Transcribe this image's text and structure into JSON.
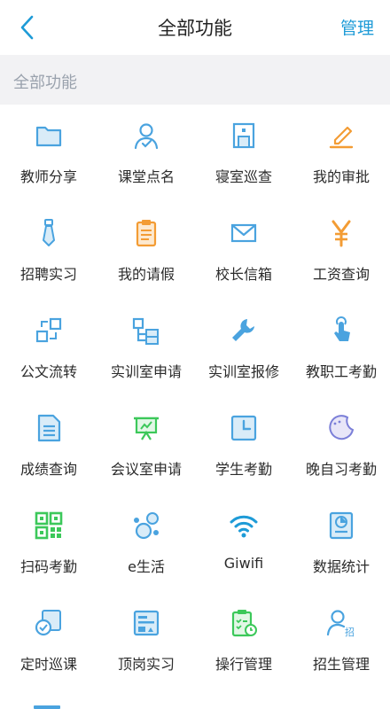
{
  "header": {
    "title": "全部功能",
    "manage_label": "管理"
  },
  "section": {
    "title": "全部功能"
  },
  "items": [
    {
      "label": "教师分享",
      "icon": "folder-icon"
    },
    {
      "label": "课堂点名",
      "icon": "user-check-icon"
    },
    {
      "label": "寝室巡查",
      "icon": "door-icon"
    },
    {
      "label": "我的审批",
      "icon": "pen-icon"
    },
    {
      "label": "招聘实习",
      "icon": "necktie-icon"
    },
    {
      "label": "我的请假",
      "icon": "clipboard-icon"
    },
    {
      "label": "校长信箱",
      "icon": "mail-icon"
    },
    {
      "label": "工资查询",
      "icon": "yen-icon"
    },
    {
      "label": "公文流转",
      "icon": "flow-icon"
    },
    {
      "label": "实训室申请",
      "icon": "tree-icon"
    },
    {
      "label": "实训室报修",
      "icon": "wrench-icon"
    },
    {
      "label": "教职工考勤",
      "icon": "hand-pointer-icon"
    },
    {
      "label": "成绩查询",
      "icon": "document-icon"
    },
    {
      "label": "会议室申请",
      "icon": "presentation-icon"
    },
    {
      "label": "学生考勤",
      "icon": "clock-icon"
    },
    {
      "label": "晚自习考勤",
      "icon": "moon-icon"
    },
    {
      "label": "扫码考勤",
      "icon": "qr-code-icon"
    },
    {
      "label": "e生活",
      "icon": "bubbles-icon"
    },
    {
      "label": "Giwifi",
      "icon": "wifi-icon"
    },
    {
      "label": "数据统计",
      "icon": "chart-icon"
    },
    {
      "label": "定时巡课",
      "icon": "patrol-icon"
    },
    {
      "label": "顶岗实习",
      "icon": "internship-icon"
    },
    {
      "label": "操行管理",
      "icon": "conduct-icon"
    },
    {
      "label": "招生管理",
      "icon": "enroll-icon"
    }
  ],
  "colors": {
    "accent": "#1e9bd7",
    "blue": "#4aa3df",
    "orange": "#f39c34",
    "green": "#3cc85a",
    "header_bg": "#f2f2f4"
  }
}
